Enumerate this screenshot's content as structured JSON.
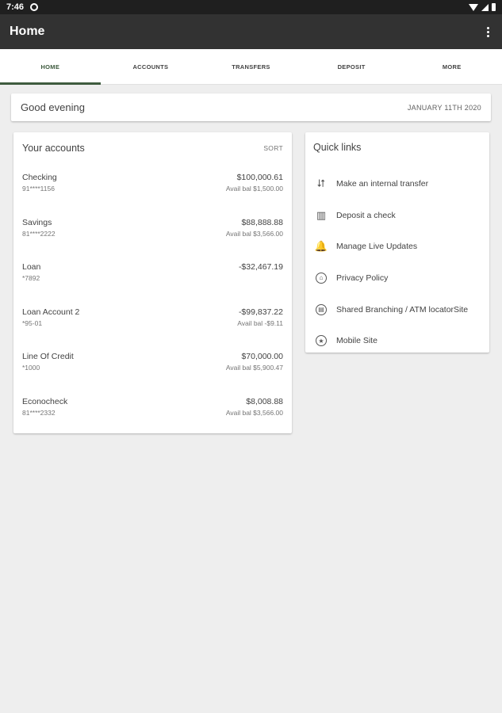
{
  "status_bar": {
    "time": "7:46"
  },
  "app_bar": {
    "title": "Home"
  },
  "tabs": [
    {
      "label": "HOME",
      "active": true
    },
    {
      "label": "ACCOUNTS",
      "active": false
    },
    {
      "label": "TRANSFERS",
      "active": false
    },
    {
      "label": "DEPOSIT",
      "active": false
    },
    {
      "label": "MORE",
      "active": false
    }
  ],
  "greeting": {
    "text": "Good evening",
    "date": "JANUARY 11TH 2020"
  },
  "accounts": {
    "title": "Your accounts",
    "sort_label": "SORT",
    "items": [
      {
        "name": "Checking",
        "number": "91****1156",
        "balance": "$100,000.61",
        "avail": "Avail bal $1,500.00"
      },
      {
        "name": "Savings",
        "number": "81****2222",
        "balance": "$88,888.88",
        "avail": "Avail bal $3,566.00"
      },
      {
        "name": "Loan",
        "number": "*7892",
        "balance": "-$32,467.19",
        "avail": ""
      },
      {
        "name": "Loan Account 2",
        "number": "*95-01",
        "balance": "-$99,837.22",
        "avail": "Avail bal -$9.11"
      },
      {
        "name": "Line Of Credit",
        "number": "*1000",
        "balance": "$70,000.00",
        "avail": "Avail bal $5,900.47"
      },
      {
        "name": "Econocheck",
        "number": "81****2332",
        "balance": "$8,008.88",
        "avail": "Avail bal $3,566.00"
      }
    ]
  },
  "quick_links": {
    "title": "Quick links",
    "items": [
      {
        "label": "Make an internal transfer",
        "icon": "transfer-icon"
      },
      {
        "label": "Deposit a check",
        "icon": "check-deposit-icon"
      },
      {
        "label": "Manage Live Updates",
        "icon": "bell-icon"
      },
      {
        "label": "Privacy Policy",
        "icon": "bank-icon"
      },
      {
        "label": "Shared Branching / ATM locatorSite",
        "icon": "atm-icon"
      },
      {
        "label": "Mobile Site",
        "icon": "star-icon"
      }
    ]
  },
  "colors": {
    "app_bar": "#323232",
    "accent": "#3e5b3e",
    "background": "#eeeeee"
  }
}
